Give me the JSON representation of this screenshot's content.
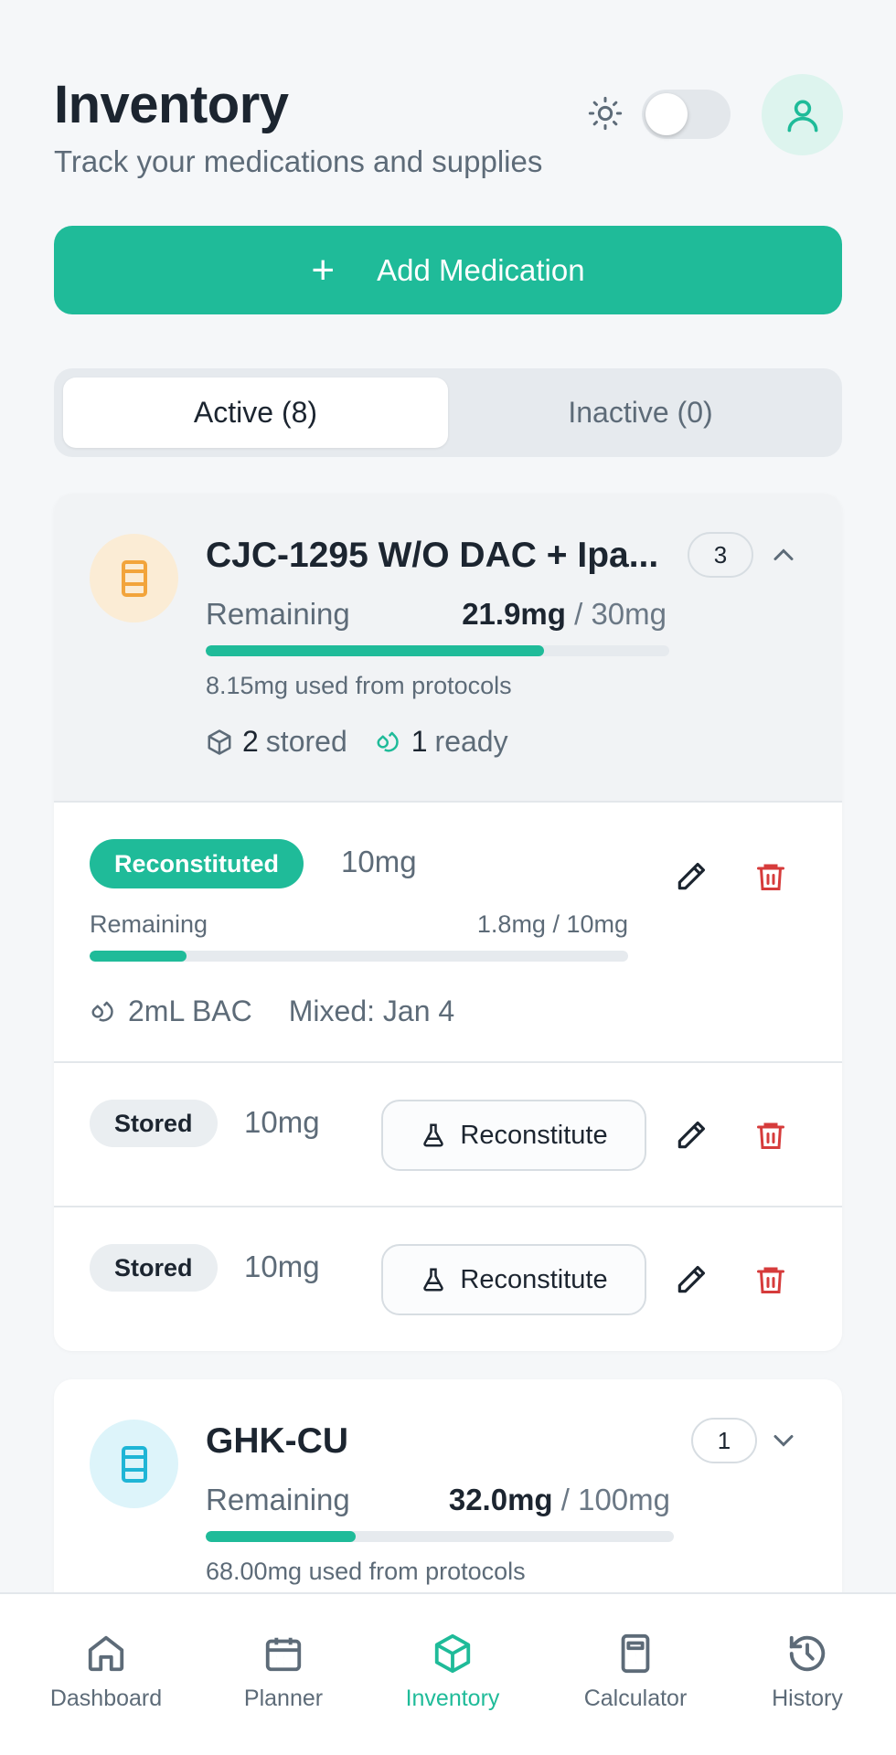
{
  "header": {
    "title": "Inventory",
    "subtitle": "Track your medications and supplies"
  },
  "icons": {
    "theme": "sun-icon",
    "avatar": "user-icon"
  },
  "add_button": {
    "label": "Add Medication"
  },
  "tabs": [
    {
      "label": "Active (8)",
      "active": true
    },
    {
      "label": "Inactive (0)",
      "active": false
    }
  ],
  "colors": {
    "accent": "#1fbb99",
    "danger": "#d63b3b",
    "orange": "#f2a43b",
    "cyan": "#1fb5d6"
  },
  "med1": {
    "name": "CJC-1295 W/O DAC + Ipa...",
    "count": "3",
    "remaining_label": "Remaining",
    "remaining_amount": "21.9mg",
    "remaining_total": "/ 30mg",
    "remaining_fraction": 0.73,
    "used": "8.15mg used from protocols",
    "stored_count": "2",
    "stored_label": "stored",
    "ready_count": "1",
    "ready_label": "ready",
    "vials": [
      {
        "status": "Reconstituted",
        "dose": "10mg",
        "remaining_label": "Remaining",
        "remaining": "1.8mg / 10mg",
        "fraction": 0.18,
        "bac": "2mL BAC",
        "mixed": "Mixed: Jan 4"
      },
      {
        "status": "Stored",
        "dose": "10mg",
        "action": "Reconstitute"
      },
      {
        "status": "Stored",
        "dose": "10mg",
        "action": "Reconstitute"
      }
    ]
  },
  "med2": {
    "name": "GHK-CU",
    "count": "1",
    "remaining_label": "Remaining",
    "remaining_amount": "32.0mg",
    "remaining_total": "/ 100mg",
    "remaining_fraction": 0.32,
    "used": "68.00mg used from protocols"
  },
  "nav": [
    {
      "label": "Dashboard",
      "icon": "home-icon"
    },
    {
      "label": "Planner",
      "icon": "calendar-icon"
    },
    {
      "label": "Inventory",
      "icon": "box-icon",
      "active": true
    },
    {
      "label": "Calculator",
      "icon": "calculator-icon"
    },
    {
      "label": "History",
      "icon": "history-icon"
    }
  ]
}
